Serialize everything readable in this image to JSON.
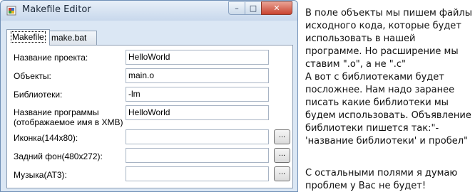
{
  "window": {
    "title": "Makefile Editor",
    "minimize_glyph": "–",
    "maximize_glyph": "□",
    "close_glyph": "✕"
  },
  "tabs": [
    {
      "label": "Makefile",
      "active": true
    },
    {
      "label": "make.bat",
      "active": false
    }
  ],
  "form": {
    "project_name": {
      "label": "Название проекта:",
      "value": "HelloWorld"
    },
    "objects": {
      "label": "Объекты:",
      "value": "main.o"
    },
    "libraries": {
      "label": "Библиотеки:",
      "value": "-lm"
    },
    "program_name": {
      "label_line1": "Название программы",
      "label_line2": "(отображаемое имя в XMB)",
      "value": "HelloWorld"
    },
    "icon": {
      "label": "Иконка(144x80):",
      "value": "",
      "browse_label": "..."
    },
    "background": {
      "label": "Задний фон(480x272):",
      "value": "",
      "browse_label": "..."
    },
    "music": {
      "label": "Музыка(AT3):",
      "value": "",
      "browse_label": "..."
    }
  },
  "notes": {
    "para1": "В поле объекты мы пишем файлы исходного кода, которые будет использовать в нашей программе. Но расширение мы ставим \".o\", а не \".c\"",
    "para2": "А вот с библиотеками будет посложнее. Нам надо заранее писать какие библиотеки мы будем использовать. Объявление библиотеки пишется так:\"-'название библиотеки' и пробел\"",
    "para3": "С остальными полями я думаю проблем у Вас не будет!"
  },
  "colors": {
    "window_frame": "#dbe7f4",
    "close_button": "#c9432f"
  },
  "icons": {
    "app": "app-icon"
  }
}
